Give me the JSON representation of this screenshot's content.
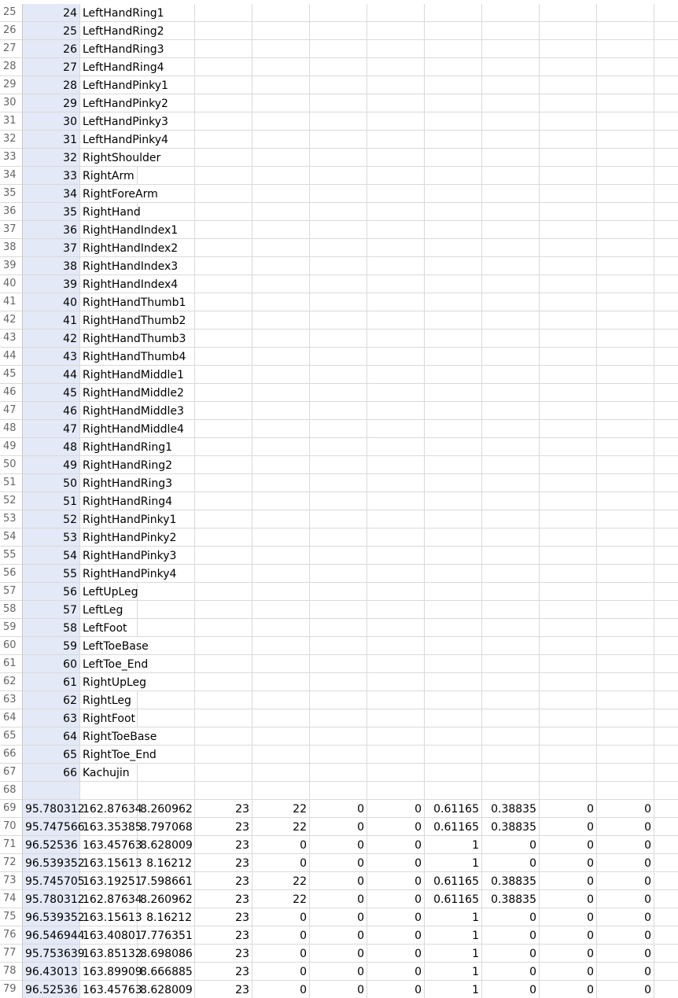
{
  "spreadsheet": {
    "column_count": 12,
    "rows": [
      {
        "n": "25",
        "cells": [
          "24",
          "LeftHandRing1"
        ]
      },
      {
        "n": "26",
        "cells": [
          "25",
          "LeftHandRing2"
        ]
      },
      {
        "n": "27",
        "cells": [
          "26",
          "LeftHandRing3"
        ]
      },
      {
        "n": "28",
        "cells": [
          "27",
          "LeftHandRing4"
        ]
      },
      {
        "n": "29",
        "cells": [
          "28",
          "LeftHandPinky1"
        ]
      },
      {
        "n": "30",
        "cells": [
          "29",
          "LeftHandPinky2"
        ]
      },
      {
        "n": "31",
        "cells": [
          "30",
          "LeftHandPinky3"
        ]
      },
      {
        "n": "32",
        "cells": [
          "31",
          "LeftHandPinky4"
        ]
      },
      {
        "n": "33",
        "cells": [
          "32",
          "RightShoulder"
        ]
      },
      {
        "n": "34",
        "cells": [
          "33",
          "RightArm"
        ]
      },
      {
        "n": "35",
        "cells": [
          "34",
          "RightForeArm"
        ]
      },
      {
        "n": "36",
        "cells": [
          "35",
          "RightHand"
        ]
      },
      {
        "n": "37",
        "cells": [
          "36",
          "RightHandIndex1"
        ]
      },
      {
        "n": "38",
        "cells": [
          "37",
          "RightHandIndex2"
        ]
      },
      {
        "n": "39",
        "cells": [
          "38",
          "RightHandIndex3"
        ]
      },
      {
        "n": "40",
        "cells": [
          "39",
          "RightHandIndex4"
        ]
      },
      {
        "n": "41",
        "cells": [
          "40",
          "RightHandThumb1"
        ]
      },
      {
        "n": "42",
        "cells": [
          "41",
          "RightHandThumb2"
        ]
      },
      {
        "n": "43",
        "cells": [
          "42",
          "RightHandThumb3"
        ]
      },
      {
        "n": "44",
        "cells": [
          "43",
          "RightHandThumb4"
        ]
      },
      {
        "n": "45",
        "cells": [
          "44",
          "RightHandMiddle1"
        ]
      },
      {
        "n": "46",
        "cells": [
          "45",
          "RightHandMiddle2"
        ]
      },
      {
        "n": "47",
        "cells": [
          "46",
          "RightHandMiddle3"
        ]
      },
      {
        "n": "48",
        "cells": [
          "47",
          "RightHandMiddle4"
        ]
      },
      {
        "n": "49",
        "cells": [
          "48",
          "RightHandRing1"
        ]
      },
      {
        "n": "50",
        "cells": [
          "49",
          "RightHandRing2"
        ]
      },
      {
        "n": "51",
        "cells": [
          "50",
          "RightHandRing3"
        ]
      },
      {
        "n": "52",
        "cells": [
          "51",
          "RightHandRing4"
        ]
      },
      {
        "n": "53",
        "cells": [
          "52",
          "RightHandPinky1"
        ]
      },
      {
        "n": "54",
        "cells": [
          "53",
          "RightHandPinky2"
        ]
      },
      {
        "n": "55",
        "cells": [
          "54",
          "RightHandPinky3"
        ]
      },
      {
        "n": "56",
        "cells": [
          "55",
          "RightHandPinky4"
        ]
      },
      {
        "n": "57",
        "cells": [
          "56",
          "LeftUpLeg"
        ]
      },
      {
        "n": "58",
        "cells": [
          "57",
          "LeftLeg"
        ]
      },
      {
        "n": "59",
        "cells": [
          "58",
          "LeftFoot"
        ]
      },
      {
        "n": "60",
        "cells": [
          "59",
          "LeftToeBase"
        ]
      },
      {
        "n": "61",
        "cells": [
          "60",
          "LeftToe_End"
        ]
      },
      {
        "n": "62",
        "cells": [
          "61",
          "RightUpLeg"
        ]
      },
      {
        "n": "63",
        "cells": [
          "62",
          "RightLeg"
        ]
      },
      {
        "n": "64",
        "cells": [
          "63",
          "RightFoot"
        ]
      },
      {
        "n": "65",
        "cells": [
          "64",
          "RightToeBase"
        ]
      },
      {
        "n": "66",
        "cells": [
          "65",
          "RightToe_End"
        ]
      },
      {
        "n": "67",
        "cells": [
          "66",
          "Kachujin"
        ]
      },
      {
        "n": "68",
        "cells": []
      },
      {
        "n": "69",
        "cells": [
          "95.780312",
          "162.87634",
          "8.260962",
          "23",
          "22",
          "0",
          "0",
          "0.61165",
          "0.38835",
          "0",
          "0"
        ]
      },
      {
        "n": "70",
        "cells": [
          "95.747566",
          "163.35385",
          "8.797068",
          "23",
          "22",
          "0",
          "0",
          "0.61165",
          "0.38835",
          "0",
          "0"
        ]
      },
      {
        "n": "71",
        "cells": [
          "96.52536",
          "163.45763",
          "8.628009",
          "23",
          "0",
          "0",
          "0",
          "1",
          "0",
          "0",
          "0"
        ]
      },
      {
        "n": "72",
        "cells": [
          "96.539352",
          "163.15613",
          "8.16212",
          "23",
          "0",
          "0",
          "0",
          "1",
          "0",
          "0",
          "0"
        ]
      },
      {
        "n": "73",
        "cells": [
          "95.745705",
          "163.19251",
          "7.598661",
          "23",
          "22",
          "0",
          "0",
          "0.61165",
          "0.38835",
          "0",
          "0"
        ]
      },
      {
        "n": "74",
        "cells": [
          "95.780312",
          "162.87634",
          "8.260962",
          "23",
          "22",
          "0",
          "0",
          "0.61165",
          "0.38835",
          "0",
          "0"
        ]
      },
      {
        "n": "75",
        "cells": [
          "96.539352",
          "163.15613",
          "8.16212",
          "23",
          "0",
          "0",
          "0",
          "1",
          "0",
          "0",
          "0"
        ]
      },
      {
        "n": "76",
        "cells": [
          "96.546944",
          "163.40801",
          "7.776351",
          "23",
          "0",
          "0",
          "0",
          "1",
          "0",
          "0",
          "0"
        ]
      },
      {
        "n": "77",
        "cells": [
          "95.753639",
          "163.85132",
          "8.698086",
          "23",
          "0",
          "0",
          "0",
          "1",
          "0",
          "0",
          "0"
        ]
      },
      {
        "n": "78",
        "cells": [
          "96.43013",
          "163.89909",
          "8.666885",
          "23",
          "0",
          "0",
          "0",
          "1",
          "0",
          "0",
          "0"
        ]
      },
      {
        "n": "79",
        "cells": [
          "96.52536",
          "163.45763",
          "8.628009",
          "23",
          "0",
          "0",
          "0",
          "1",
          "0",
          "0",
          "0"
        ]
      }
    ]
  }
}
